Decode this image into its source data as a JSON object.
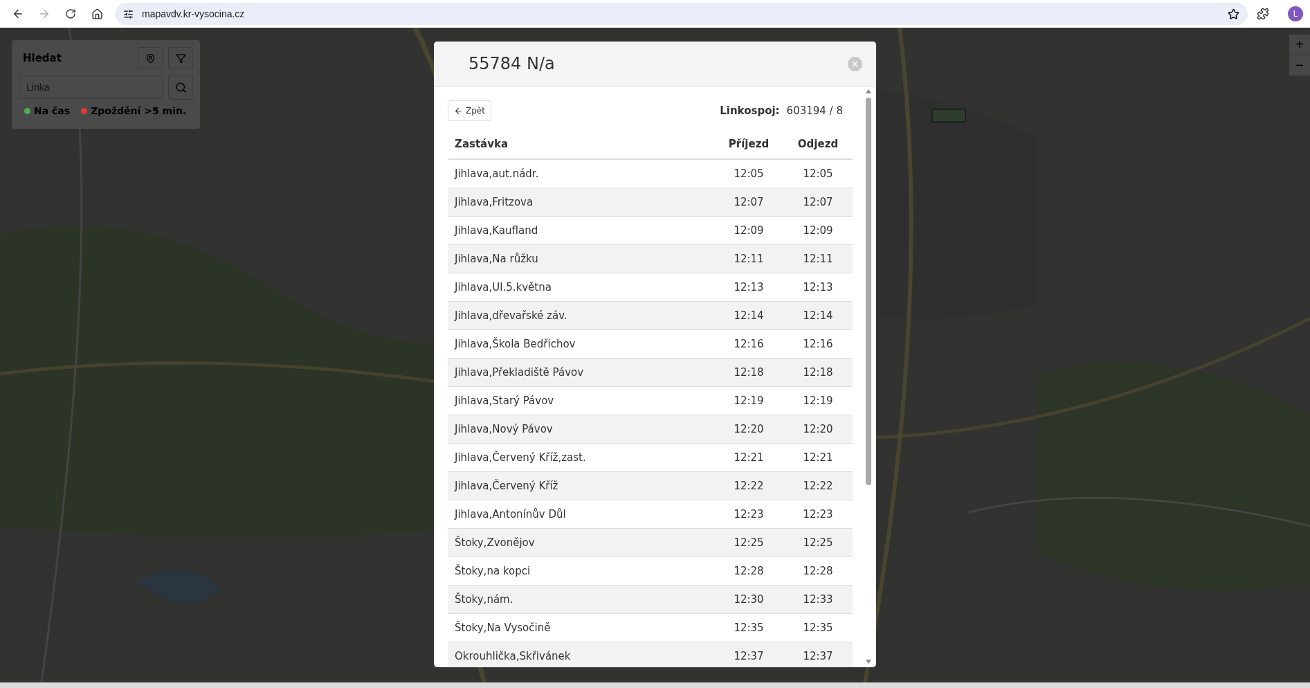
{
  "browser": {
    "url": "mapavdv.kr-vysocina.cz",
    "profile_initial": "L"
  },
  "search_panel": {
    "title": "Hledat",
    "placeholder": "Linka",
    "legend": [
      {
        "label": "Na čas",
        "color": "#4caf50"
      },
      {
        "label": "Zpoždění >5 min.",
        "color": "#e53935"
      }
    ]
  },
  "zoom": {
    "in": "+",
    "out": "−"
  },
  "modal": {
    "title": "55784 N/a",
    "back": "Zpět",
    "trip_label": "Linkospoj:",
    "trip_value": "603194 / 8",
    "columns": [
      "Zastávka",
      "Příjezd",
      "Odjezd"
    ],
    "rows": [
      {
        "stop": "Jihlava,aut.nádr.",
        "arrival": "12:05",
        "departure": "12:05"
      },
      {
        "stop": "Jihlava,Fritzova",
        "arrival": "12:07",
        "departure": "12:07"
      },
      {
        "stop": "Jihlava,Kaufland",
        "arrival": "12:09",
        "departure": "12:09"
      },
      {
        "stop": "Jihlava,Na růžku",
        "arrival": "12:11",
        "departure": "12:11"
      },
      {
        "stop": "Jihlava,Ul.5.května",
        "arrival": "12:13",
        "departure": "12:13"
      },
      {
        "stop": "Jihlava,dřevařské záv.",
        "arrival": "12:14",
        "departure": "12:14"
      },
      {
        "stop": "Jihlava,Škola Bedřichov",
        "arrival": "12:16",
        "departure": "12:16"
      },
      {
        "stop": "Jihlava,Překladiště Pávov",
        "arrival": "12:18",
        "departure": "12:18"
      },
      {
        "stop": "Jihlava,Starý Pávov",
        "arrival": "12:19",
        "departure": "12:19"
      },
      {
        "stop": "Jihlava,Nový Pávov",
        "arrival": "12:20",
        "departure": "12:20"
      },
      {
        "stop": "Jihlava,Červený Kříž,zast.",
        "arrival": "12:21",
        "departure": "12:21"
      },
      {
        "stop": "Jihlava,Červený Kříž",
        "arrival": "12:22",
        "departure": "12:22"
      },
      {
        "stop": "Jihlava,Antonínův Důl",
        "arrival": "12:23",
        "departure": "12:23"
      },
      {
        "stop": "Štoky,Zvonějov",
        "arrival": "12:25",
        "departure": "12:25"
      },
      {
        "stop": "Štoky,na kopci",
        "arrival": "12:28",
        "departure": "12:28"
      },
      {
        "stop": "Štoky,nám.",
        "arrival": "12:30",
        "departure": "12:33"
      },
      {
        "stop": "Štoky,Na Vysočině",
        "arrival": "12:35",
        "departure": "12:35"
      },
      {
        "stop": "Okrouhlička,Skřivánek",
        "arrival": "12:37",
        "departure": "12:37"
      }
    ]
  }
}
